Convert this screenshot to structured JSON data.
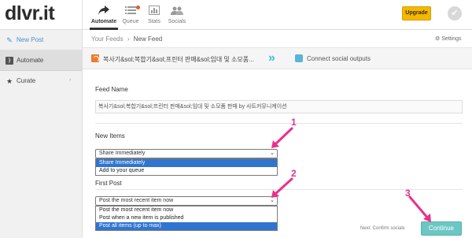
{
  "app": {
    "logo": "dlvr.it"
  },
  "topnav": {
    "tabs": [
      {
        "label": "Automate",
        "icon": "share-arrow-icon",
        "active": true
      },
      {
        "label": "Queue",
        "icon": "list-icon",
        "active": false
      },
      {
        "label": "Stats",
        "icon": "bar-chart-icon",
        "active": false
      },
      {
        "label": "Socials",
        "icon": "people-icon",
        "active": false
      }
    ],
    "upgrade_label": "Upgrade",
    "avatar_icon": "checkmark-avatar-icon"
  },
  "sidebar": {
    "items": [
      {
        "label": "New Post",
        "icon": "pencil-icon"
      },
      {
        "label": "Automate",
        "icon": "rss-icon",
        "selected": true
      },
      {
        "label": "Curate",
        "icon": "star-icon",
        "chevron": "›"
      }
    ]
  },
  "breadcrumb": {
    "parent": "Your Feeds",
    "separator": "›",
    "current": "New Feed"
  },
  "settings_label": "Settings",
  "stepbar": {
    "source_label": "복사기&sol;복합기&sol;프린터 판매&sol;임대 및 소모품...",
    "arrows": "»",
    "social_label": "Connect social outputs"
  },
  "form": {
    "feed_name_label": "Feed Name",
    "feed_name_value": "복사기&sol;복합기&sol;프린터 판매&sol;임대 및 소모품 판매 by 사트커뮤니케이션",
    "new_items_label": "New Items",
    "new_items_selected": "Share Immediately",
    "new_items_options": [
      "Share Immediately",
      "Add to your queue"
    ],
    "first_post_label": "First Post",
    "first_post_selected": "Post the most recent item now",
    "first_post_options": [
      "Post the most recent item now",
      "Post when a new item is published",
      "Post all items (up to max)"
    ]
  },
  "footer": {
    "next_text": "Next: Confirm socials",
    "continue_label": "Continue"
  },
  "annotations": {
    "callouts": [
      "1",
      "2",
      "3"
    ],
    "color": "#e8318c"
  }
}
